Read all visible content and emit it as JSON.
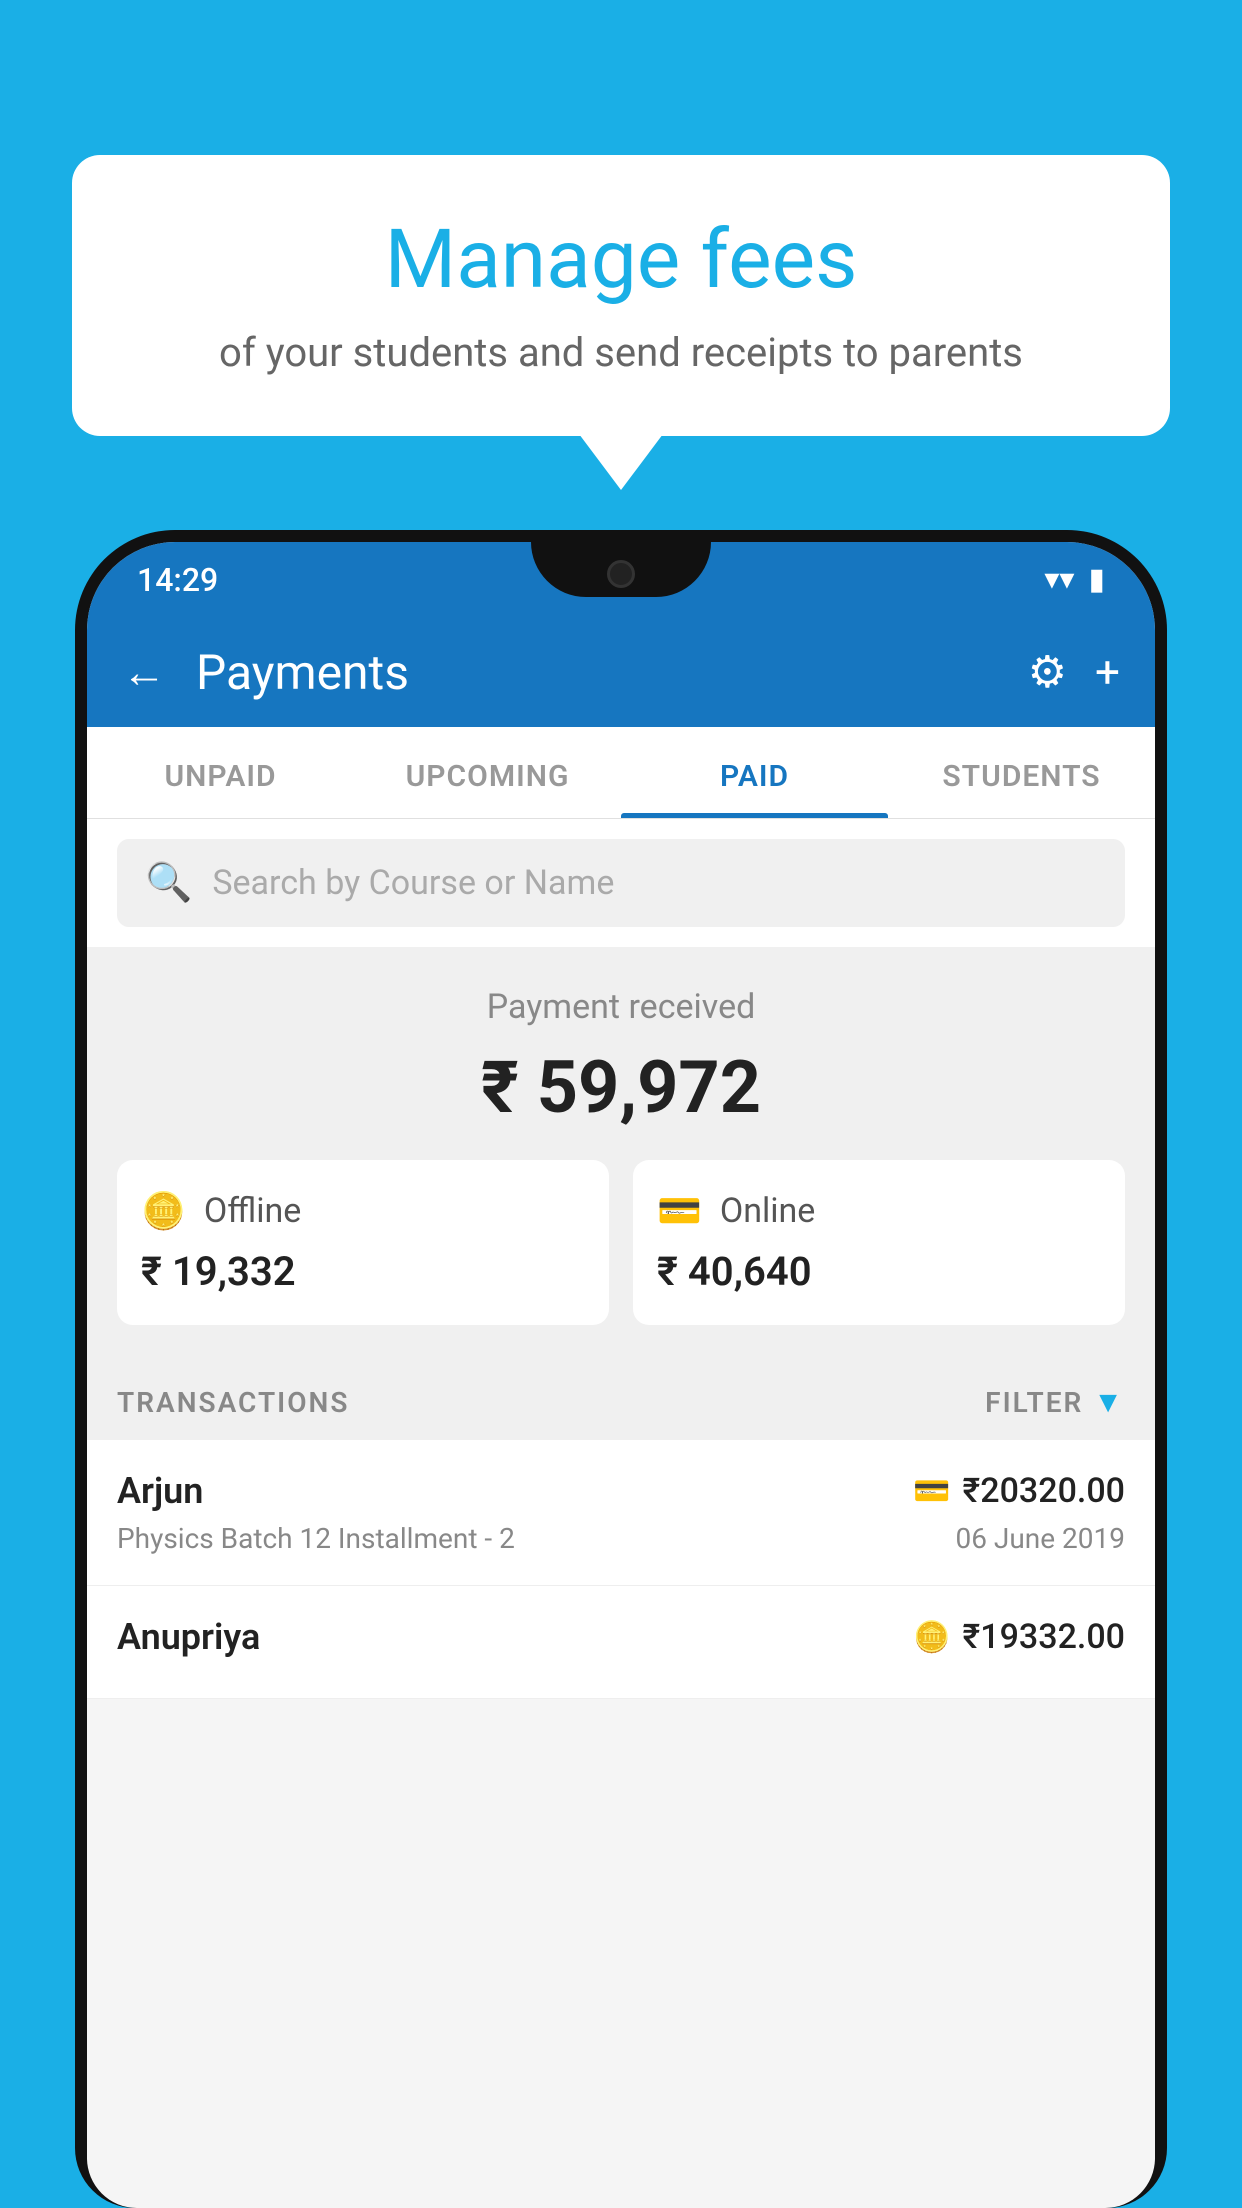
{
  "page": {
    "background_color": "#1AAFE6"
  },
  "bubble": {
    "title": "Manage fees",
    "subtitle": "of your students and send receipts to parents"
  },
  "status_bar": {
    "time": "14:29",
    "wifi": "▾",
    "signal": "▾",
    "battery": "▮"
  },
  "header": {
    "title": "Payments",
    "back_label": "←",
    "gear_label": "⚙",
    "plus_label": "+"
  },
  "tabs": [
    {
      "label": "UNPAID",
      "active": false
    },
    {
      "label": "UPCOMING",
      "active": false
    },
    {
      "label": "PAID",
      "active": true
    },
    {
      "label": "STUDENTS",
      "active": false
    }
  ],
  "search": {
    "placeholder": "Search by Course or Name"
  },
  "payment_summary": {
    "received_label": "Payment received",
    "total_amount": "₹ 59,972",
    "offline_label": "Offline",
    "offline_amount": "₹ 19,332",
    "online_label": "Online",
    "online_amount": "₹ 40,640"
  },
  "transactions": {
    "section_label": "TRANSACTIONS",
    "filter_label": "FILTER",
    "rows": [
      {
        "name": "Arjun",
        "description": "Physics Batch 12 Installment - 2",
        "amount": "₹20320.00",
        "date": "06 June 2019",
        "method": "card"
      },
      {
        "name": "Anupriya",
        "description": "",
        "amount": "₹19332.00",
        "date": "",
        "method": "cash"
      }
    ]
  }
}
